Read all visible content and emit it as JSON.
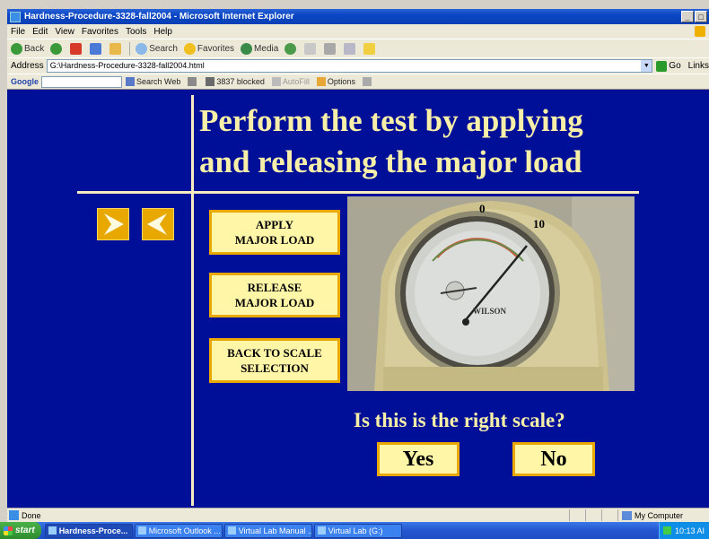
{
  "window": {
    "title": "Hardness-Procedure-3328-fall2004 - Microsoft Internet Explorer",
    "min": "_",
    "max": "□"
  },
  "menu": [
    "File",
    "Edit",
    "View",
    "Favorites",
    "Tools",
    "Help"
  ],
  "toolbar": {
    "back": "Back",
    "search": "Search",
    "favorites": "Favorites",
    "media": "Media"
  },
  "address": {
    "label": "Address",
    "value": "G:\\Hardness-Procedure-3328-fall2004.html",
    "go": "Go",
    "links": "Links"
  },
  "google": {
    "logo": "Google",
    "search_web": "Search Web",
    "blocked": "3837 blocked",
    "autofill": "AutoFill",
    "options": "Options"
  },
  "page": {
    "headline_line1": "Perform the test by applying",
    "headline_line2": "and releasing the major load",
    "buttons": {
      "apply_line1": "APPLY",
      "apply_line2": "MAJOR LOAD",
      "release_line1": "RELEASE",
      "release_line2": "MAJOR LOAD",
      "back_line1": "BACK TO SCALE",
      "back_line2": "SELECTION"
    },
    "dial": {
      "zero": "0",
      "ten": "10",
      "brand": "WILSON"
    },
    "question": "Is this is the right scale?",
    "yes": "Yes",
    "no": "No",
    "colors": {
      "background": "#000f98",
      "accent": "#e8a800",
      "text": "#f7efa8"
    }
  },
  "status": {
    "text": "Done",
    "zone": "My Computer"
  },
  "taskbar": {
    "start": "start",
    "tasks": [
      "Hardness-Proce...",
      "Microsoft Outlook ...",
      "Virtual Lab Manual ...",
      "Virtual Lab (G:)"
    ],
    "clock": "10:13 AI"
  }
}
